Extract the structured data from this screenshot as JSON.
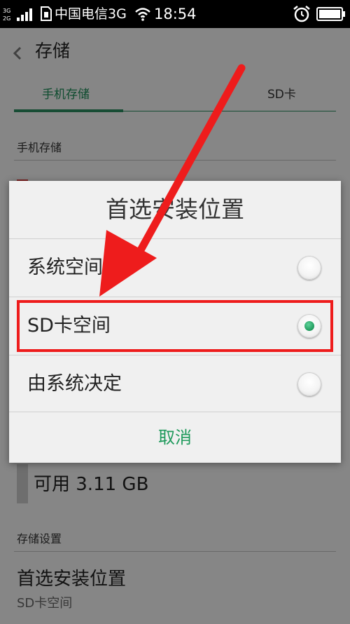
{
  "status_bar": {
    "network_top": "3G",
    "network_bottom": "2G",
    "carrier": "中国电信3G",
    "time": "18:54"
  },
  "header": {
    "title": "存储"
  },
  "tabs": [
    {
      "label": "手机存储",
      "selected": true
    },
    {
      "label": "SD卡",
      "selected": false
    }
  ],
  "sections": {
    "phone_storage": "手机存储",
    "available": "可用 3.11 GB",
    "settings": "存储设置",
    "preferred_install": {
      "title": "首选安装位置",
      "value": "SD卡空间"
    }
  },
  "dialog": {
    "title": "首选安装位置",
    "options": [
      {
        "label": "系统空间",
        "selected": false
      },
      {
        "label": "SD卡空间",
        "selected": true
      },
      {
        "label": "由系统决定",
        "selected": false
      }
    ],
    "cancel_label": "取消"
  },
  "colors": {
    "accent": "#1f9a5c",
    "annotation": "#ee1c1c",
    "status_bar": "#000000"
  },
  "icons": [
    "signal-icon",
    "sim-icon",
    "wifi-icon",
    "alarm-icon",
    "battery-icon",
    "back-chevron-icon",
    "annotation-arrow-icon"
  ]
}
